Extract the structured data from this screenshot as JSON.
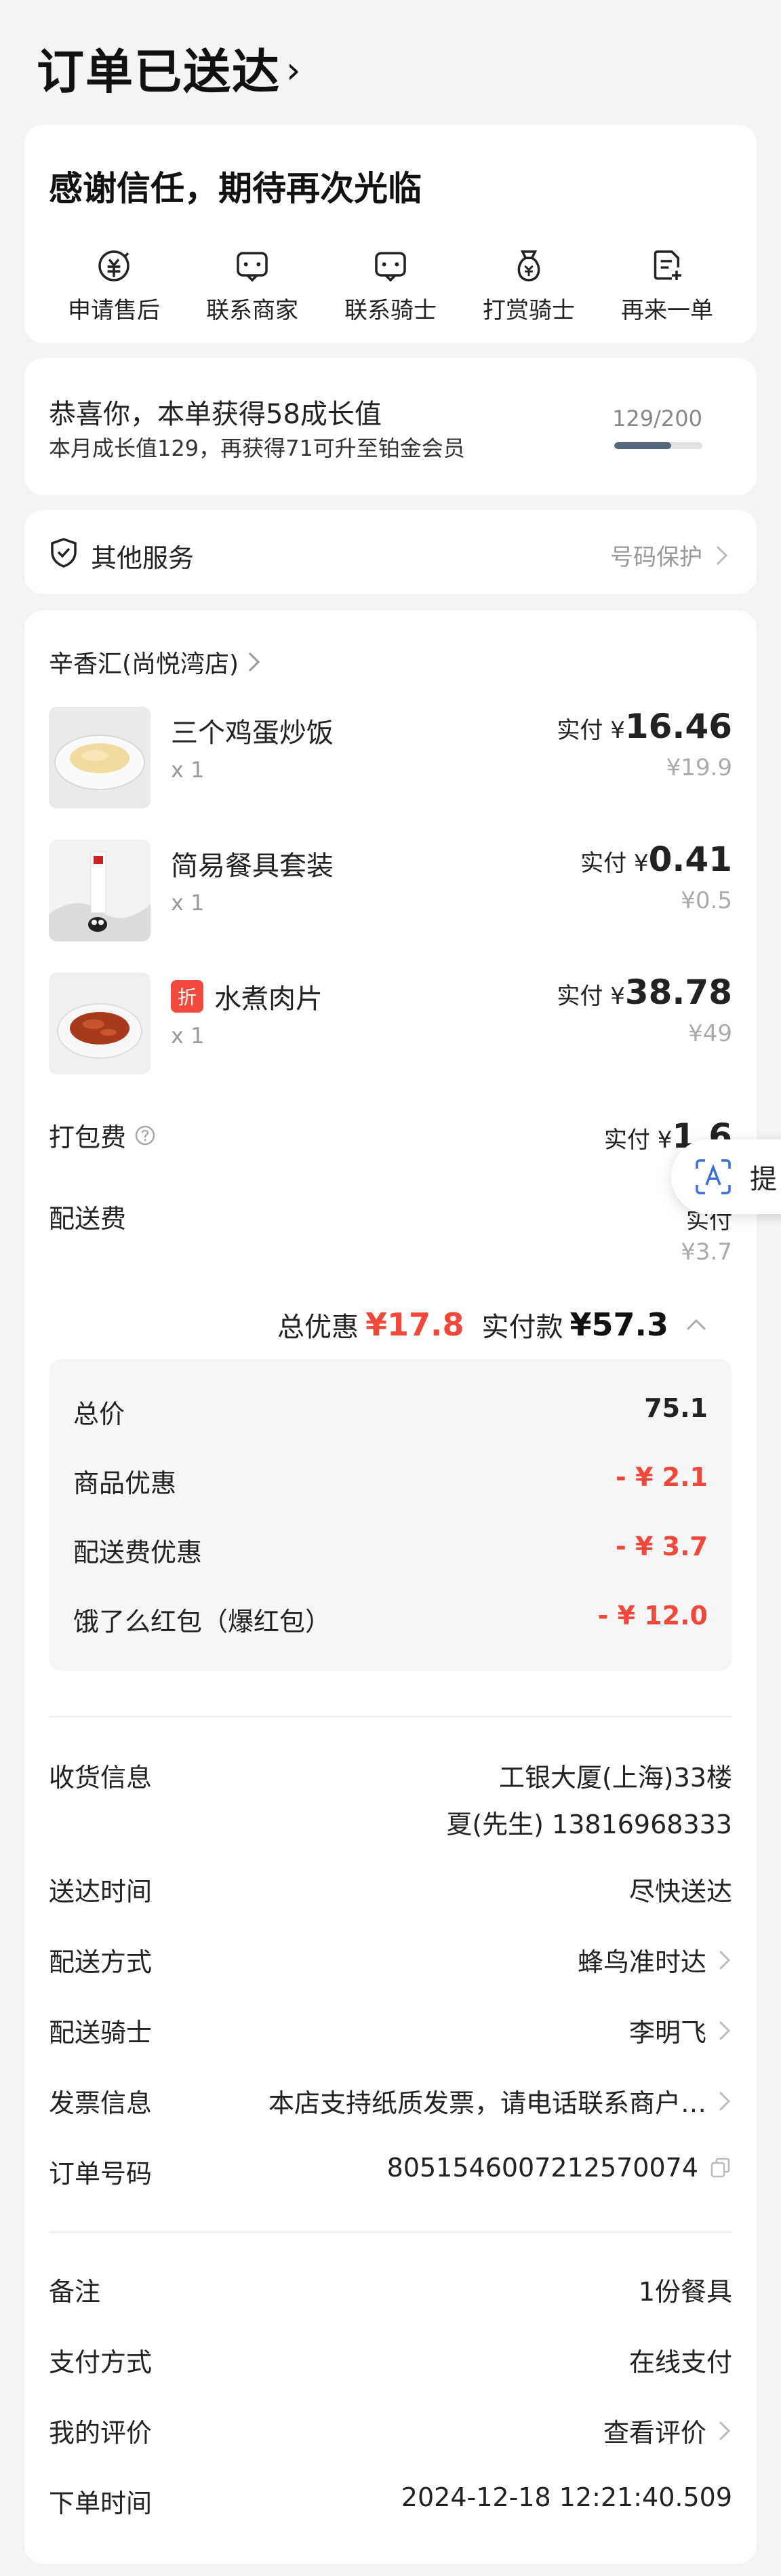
{
  "header": {
    "title": "订单已送达"
  },
  "thanks": {
    "headline": "感谢信任，期待再次光临",
    "actions": [
      {
        "label": "申请售后",
        "icon": "after-sale-icon"
      },
      {
        "label": "联系商家",
        "icon": "chat-icon"
      },
      {
        "label": "联系骑士",
        "icon": "chat-icon"
      },
      {
        "label": "打赏骑士",
        "icon": "money-bag-icon"
      },
      {
        "label": "再来一单",
        "icon": "reorder-icon"
      }
    ]
  },
  "growth": {
    "line1": "恭喜你，本单获得58成长值",
    "line2": "本月成长值129，再获得71可升至铂金会员",
    "progress_text": "129/200",
    "progress_fraction": 0.645
  },
  "services": {
    "label": "其他服务",
    "right": "号码保护"
  },
  "order": {
    "store": "辛香汇(尚悦湾店)",
    "items": [
      {
        "name": "三个鸡蛋炒饭",
        "qty": "x 1",
        "paid_label": "实付 ¥",
        "paid": "16.46",
        "original": "¥19.9"
      },
      {
        "name": "简易餐具套装",
        "qty": "x 1",
        "paid_label": "实付 ¥",
        "paid": "0.41",
        "original": "¥0.5"
      },
      {
        "name": "水煮肉片",
        "tag": "折",
        "qty": "x 1",
        "paid_label": "实付 ¥",
        "paid": "38.78",
        "original": "¥49"
      }
    ],
    "packing": {
      "label": "打包费",
      "paid_label": "实付 ¥",
      "paid": "1.6"
    },
    "delivery": {
      "label": "配送费",
      "paid_label": "实付",
      "original": "¥3.7"
    },
    "float_button": {
      "label": "提"
    },
    "totals": {
      "discount_label": "总优惠",
      "discount": "¥17.8",
      "paid_label": "实付款",
      "paid": "¥57.3"
    },
    "breakdown": [
      {
        "label": "总价",
        "value": "75.1",
        "red": false
      },
      {
        "label": "商品优惠",
        "value": "- ¥ 2.1",
        "red": true
      },
      {
        "label": "配送费优惠",
        "value": "- ¥ 3.7",
        "red": true
      },
      {
        "label": "饿了么红包（爆红包）",
        "value": "- ¥ 12.0",
        "red": true
      }
    ],
    "info": {
      "receiver_label": "收货信息",
      "receiver_line1": "工银大厦(上海)33楼",
      "receiver_line2": "夏(先生) 13816968333",
      "arrive_label": "送达时间",
      "arrive_value": "尽快送达",
      "method_label": "配送方式",
      "method_value": "蜂鸟准时达",
      "rider_label": "配送骑士",
      "rider_value": "李明飞",
      "invoice_label": "发票信息",
      "invoice_value": "本店支持纸质发票，请电话联系商户…",
      "order_no_label": "订单号码",
      "order_no_value": "8051546007212570074",
      "note_label": "备注",
      "note_value": "1份餐具",
      "pay_label": "支付方式",
      "pay_value": "在线支付",
      "review_label": "我的评价",
      "review_value": "查看评价",
      "time_label": "下单时间",
      "time_value": "2024-12-18 12:21:40.509"
    }
  },
  "colors": {
    "accent_red": "#f0483a",
    "bg": "#f4f4f4",
    "progress": "#55657a"
  }
}
